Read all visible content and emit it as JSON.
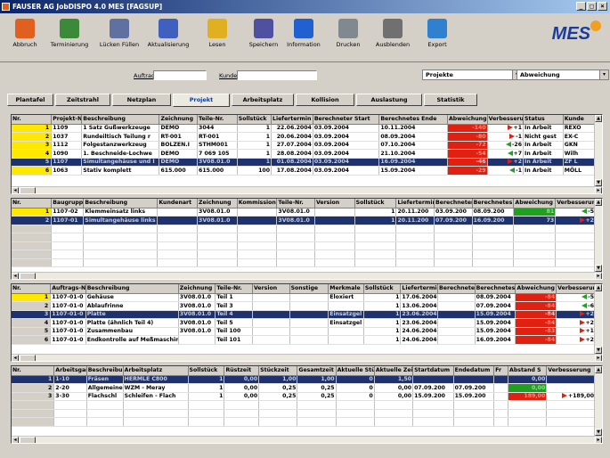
{
  "window": {
    "title": "FAUSER AG JobDISPO 4.0 MES  [FAGSUP]",
    "controls": [
      "_",
      "□",
      "×"
    ]
  },
  "toolbar": {
    "buttons": [
      {
        "label": "Abbruch",
        "icon": "stop-icon",
        "color": "#e06020"
      },
      {
        "label": "Terminierung",
        "icon": "schedule-icon",
        "color": "#3a8a3a"
      },
      {
        "label": "Lücken Füllen",
        "icon": "gap-fill-icon",
        "color": "#6070a0"
      },
      {
        "label": "Aktualisierung",
        "icon": "refresh-icon",
        "color": "#4060c0"
      },
      {
        "label": "Lesen",
        "icon": "folder-open-icon",
        "color": "#e0b020"
      },
      {
        "label": "Speichern",
        "icon": "save-icon",
        "color": "#5050a0"
      },
      {
        "label": "Information",
        "icon": "info-icon",
        "color": "#2060d0"
      },
      {
        "label": "Drucken",
        "icon": "printer-icon",
        "color": "#808890"
      },
      {
        "label": "Ausblenden",
        "icon": "hide-icon",
        "color": "#707070"
      },
      {
        "label": "Export",
        "icon": "export-icon",
        "color": "#3080d0"
      }
    ],
    "logo": "MES"
  },
  "filter": {
    "auftrag_label": "Auftrag",
    "kunde_label": "Kunde",
    "view_select": "Projekte",
    "mode_select": "Abweichung"
  },
  "tabs": [
    "Plantafel",
    "Zeitstrahl",
    "Netzplan",
    "Projekt",
    "Arbeitsplatz",
    "Kollision",
    "Auslastung",
    "Statistik"
  ],
  "active_tab": "Projekt",
  "colors": {
    "highlight_red": "#e02010",
    "highlight_green": "#20a020",
    "row_yellow": "#ffe800",
    "selection": "#1e3270"
  },
  "projects": {
    "columns": [
      "Nr.",
      "Projekt-Nr.",
      "Beschreibung",
      "Zeichnung",
      "Teile-Nr.",
      "Sollstück",
      "Liefertermin",
      "Berechneter Start",
      "Berechnetes Ende",
      "Abweichung",
      "Verbesserung",
      "Status",
      "Kunde"
    ],
    "rows": [
      {
        "nr": "1",
        "projekt": "1109",
        "beschreibung": "1 Satz Gußwerkzeuge",
        "zeichnung": "DEMO",
        "teile": "3044",
        "soll": "1",
        "liefer": "22.06.2004",
        "start": "03.09.2004",
        "ende": "10.11.2004",
        "abw": "-140",
        "verb": "+1",
        "status": "In Arbeit",
        "kunde": "REXO",
        "dir": "r"
      },
      {
        "nr": "2",
        "projekt": "1037",
        "beschreibung": "Rundeiltisch Teilung r",
        "zeichnung": "RT-001",
        "teile": "RT-001",
        "soll": "1",
        "liefer": "20.06.2004",
        "start": "03.09.2004",
        "ende": "08.09.2004",
        "abw": "-80",
        "verb": "-1",
        "status": "Nicht gest",
        "kunde": "EX-C",
        "dir": "r"
      },
      {
        "nr": "3",
        "projekt": "1112",
        "beschreibung": "Folgestanzwerkzeug",
        "zeichnung": "BOLZEN.I",
        "teile": "STHM001",
        "soll": "1",
        "liefer": "27.07.2004",
        "start": "03.09.2004",
        "ende": "07.10.2004",
        "abw": "-72",
        "verb": "-26",
        "status": "In Arbeit",
        "kunde": "GKN",
        "dir": "l"
      },
      {
        "nr": "4",
        "projekt": "1090",
        "beschreibung": "1. Beschneide-Lochwe",
        "zeichnung": "DEMO",
        "teile": "7 069 105",
        "soll": "1",
        "liefer": "28.08.2004",
        "start": "03.09.2004",
        "ende": "21.10.2004",
        "abw": "-54",
        "verb": "+7",
        "status": "In Arbeit",
        "kunde": "Wilh",
        "dir": "l"
      },
      {
        "nr": "5",
        "projekt": "1107",
        "beschreibung": "Simultangehäuse und I",
        "zeichnung": "DEMO",
        "teile": "3V08.01.0",
        "soll": "1",
        "liefer": "01.08.2004",
        "start": "03.09.2004",
        "ende": "16.09.2004",
        "abw": "-46",
        "verb": "+2",
        "status": "In Arbeit",
        "kunde": "ZF L",
        "dir": "r",
        "selected": true
      },
      {
        "nr": "6",
        "projekt": "1063",
        "beschreibung": "Stativ komplett",
        "zeichnung": "615.000",
        "teile": "615.000",
        "soll": "100",
        "liefer": "17.08.2004",
        "start": "03.09.2004",
        "ende": "15.09.2004",
        "abw": "-29",
        "verb": "-1",
        "status": "In Arbeit",
        "kunde": "MÖLL",
        "dir": "l"
      }
    ]
  },
  "assemblies": {
    "columns": [
      "Nr.",
      "Baugruppe",
      "Beschreibung",
      "Kundenart",
      "Zeichnung",
      "Kommission",
      "Teile-Nr.",
      "Version",
      "Sollstück",
      "Liefertermin",
      "Berechneter Start",
      "Berechnetes Ende",
      "Abweichung",
      "Verbesserung"
    ],
    "rows": [
      {
        "nr": "1",
        "bg": "1107-02",
        "beschreibung": "Klemmeinsatz links",
        "kunden": "",
        "zeichnung": "3V08.01.0",
        "kommission": "",
        "teile": "3V08.01.0",
        "version": "",
        "soll": "1",
        "liefer": "20.11.200",
        "start": "03.09.200",
        "ende": "08.09.200",
        "abw": "81",
        "verb": "-5",
        "cls": "green",
        "dir": "l"
      },
      {
        "nr": "2",
        "bg": "1107-01",
        "beschreibung": "Simultangehäuse links",
        "kunden": "",
        "zeichnung": "3V08.01.0",
        "kommission": "",
        "teile": "3V08.01.0",
        "version": "",
        "soll": "1",
        "liefer": "20.11.200",
        "start": "07.09.200",
        "ende": "16.09.200",
        "abw": "73",
        "verb": "+2",
        "cls": "",
        "dir": "r",
        "selected": true
      }
    ]
  },
  "orders": {
    "columns": [
      "Nr.",
      "Auftrags-Nr.",
      "Beschreibung",
      "Zeichnung",
      "Teile-Nr.",
      "Version",
      "Sonstige",
      "Merkmale",
      "Sollstück",
      "Liefertermin",
      "Berechneter Start",
      "Berechnetes Ende",
      "Abweichung",
      "Verbesserung"
    ],
    "rows": [
      {
        "nr": "1",
        "auftrag": "1107-01-0",
        "beschreibung": "Gehäuse",
        "zeichnung": "3V08.01.0",
        "teile": "Teil 1",
        "version": "",
        "sonstige": "",
        "merkmale": "Eloxiert",
        "soll": "1",
        "liefer": "17.06.2004",
        "ende": "08.09.2004",
        "abw": "-84",
        "verb": "-5",
        "dir": "l",
        "yellow": true
      },
      {
        "nr": "2",
        "auftrag": "1107-01-0",
        "beschreibung": "Ablaufrinne",
        "zeichnung": "3V08.01.0",
        "teile": "Teil 3",
        "version": "",
        "sonstige": "",
        "merkmale": "",
        "soll": "1",
        "liefer": "13.06.2004",
        "ende": "07.09.2004",
        "abw": "-84",
        "verb": "-6",
        "dir": "l"
      },
      {
        "nr": "3",
        "auftrag": "1107-01-0",
        "beschreibung": "Platte",
        "zeichnung": "3V08.01.0",
        "teile": "Teil 4",
        "version": "",
        "sonstige": "",
        "merkmale": "Einsatzgel",
        "soll": "1",
        "liefer": "23.06.2004",
        "ende": "15.09.2004",
        "abw": "-84",
        "verb": "+2",
        "dir": "r",
        "selected": true
      },
      {
        "nr": "4",
        "auftrag": "1107-01-0",
        "beschreibung": "Platte (ähnlich Teil 4)",
        "zeichnung": "3V08.01.0",
        "teile": "Teil 5",
        "version": "",
        "sonstige": "",
        "merkmale": "Einsatzgel",
        "soll": "1",
        "liefer": "23.06.2004",
        "ende": "15.09.2004",
        "abw": "-84",
        "verb": "+2",
        "dir": "r"
      },
      {
        "nr": "5",
        "auftrag": "1107-01-0",
        "beschreibung": "Zusammenbau",
        "zeichnung": "3V08.01.0",
        "teile": "Teil 100",
        "version": "",
        "sonstige": "",
        "merkmale": "",
        "soll": "1",
        "liefer": "24.06.2004",
        "ende": "15.09.2004",
        "abw": "-83",
        "verb": "+1",
        "dir": "r"
      },
      {
        "nr": "6",
        "auftrag": "1107-01-0",
        "beschreibung": "Endkontrolle auf Meßmaschine",
        "zeichnung": "",
        "teile": "Teil 101",
        "version": "",
        "sonstige": "",
        "merkmale": "",
        "soll": "1",
        "liefer": "24.06.2004",
        "ende": "16.09.2004",
        "abw": "-84",
        "verb": "+2",
        "dir": "r"
      }
    ]
  },
  "operations": {
    "columns": [
      "Nr.",
      "Arbeitsgang",
      "Beschreibung",
      "Arbeitsplatz",
      "Sollstück",
      "Rüstzeit",
      "Stückzeit",
      "Gesamtzeit",
      "Aktuelle Stück",
      "Aktuelle Zeit",
      "Startdatum",
      "Endedatum",
      "Fr",
      "Abstand S",
      "Verbesserung"
    ],
    "rows": [
      {
        "nr": "1",
        "ag": "1-10",
        "beschreibung": "Fräsen",
        "platz": "HERMLE C800",
        "soll": "1",
        "ruest": "0,00",
        "stueck": "1,00",
        "gesamt": "1,00",
        "akt_s": "0",
        "akt_z": "1,50",
        "start": "",
        "ende": "",
        "fr": "",
        "abstand": "0,00",
        "verb": "",
        "cls": "",
        "selected": true
      },
      {
        "nr": "2",
        "ag": "2-20",
        "beschreibung": "Allgemeine",
        "platz": "WZM - Meray",
        "soll": "1",
        "ruest": "0,00",
        "stueck": "0,25",
        "gesamt": "0,25",
        "akt_s": "0",
        "akt_z": "0,00",
        "start": "07.09.200",
        "ende": "07.09.200",
        "fr": "",
        "abstand": "0,00",
        "verb": "",
        "cls": "green"
      },
      {
        "nr": "3",
        "ag": "3-30",
        "beschreibung": "Flachschl",
        "platz": "Schleifen - Flach",
        "soll": "1",
        "ruest": "0,00",
        "stueck": "0,25",
        "gesamt": "0,25",
        "akt_s": "0",
        "akt_z": "0,00",
        "start": "15.09.200",
        "ende": "15.09.200",
        "fr": "",
        "abstand": "189,00",
        "verb": "+189,00",
        "cls": "red",
        "dir": "r"
      }
    ]
  }
}
